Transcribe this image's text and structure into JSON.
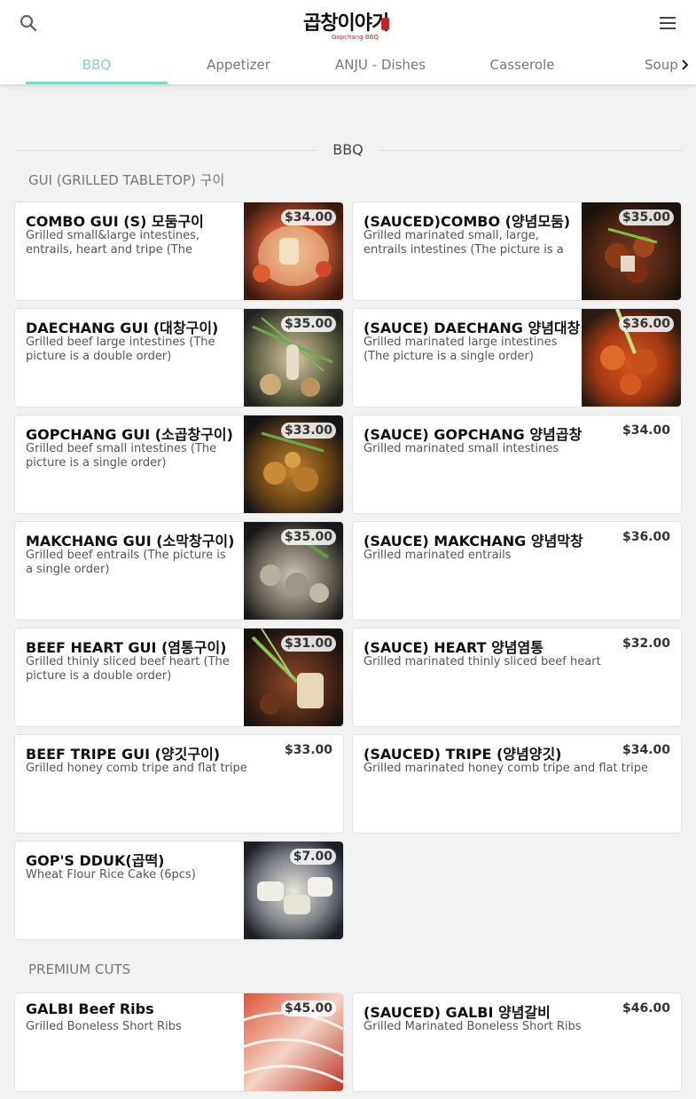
{
  "header": {
    "logo_text": "곱창이야기",
    "logo_subtitle": "Gopchang BBQ",
    "search_icon": "search-icon",
    "menu_icon": "menu-icon"
  },
  "tabs": [
    {
      "label": "BBQ",
      "active": true
    },
    {
      "label": "Appetizer",
      "active": false
    },
    {
      "label": "ANJU - Dishes",
      "active": false
    },
    {
      "label": "Casserole",
      "active": false
    },
    {
      "label": "Soup",
      "active": false
    }
  ],
  "accent_color": "#7fd3c7",
  "section": {
    "title": "BBQ",
    "categories": [
      {
        "name": "GUI (GRILLED TABLETOP) 구이",
        "items": [
          {
            "name": "COMBO GUI (S) 모둠구이",
            "description": "Grilled small&large intestines, entrails, heart and tripe (The picture is a double order)",
            "price": "$34.00",
            "image": "combo-gui-photo"
          },
          {
            "name": "(SAUCED)COMBO (양념모둠)",
            "description": "Grilled marinated small, large, entrails intestines (The picture is a double order)",
            "price": "$35.00",
            "image": "sauced-combo-photo"
          },
          {
            "name": "DAECHANG GUI (대창구이)",
            "description": "Grilled beef large intestines (The picture is a double order)",
            "price": "$35.00",
            "image": "daechang-gui-photo"
          },
          {
            "name": "(SAUCE) DAECHANG 양념대창",
            "description": "Grilled marinated large intestines (The picture is a single order)",
            "price": "$36.00",
            "image": "sauce-daechang-photo"
          },
          {
            "name": "GOPCHANG GUI (소곱창구이)",
            "description": "Grilled beef small intestines (The picture is a single order)",
            "price": "$33.00",
            "image": "gopchang-gui-photo"
          },
          {
            "name": "(SAUCE) GOPCHANG 양념곱창",
            "description": "Grilled marinated small intestines",
            "price": "$34.00",
            "image": ""
          },
          {
            "name": "MAKCHANG GUI (소막창구이)",
            "description": "Grilled beef entrails (The picture is a single order)",
            "price": "$35.00",
            "image": "makchang-gui-photo"
          },
          {
            "name": "(SAUCE) MAKCHANG 양념막창",
            "description": "Grilled marinated entrails",
            "price": "$36.00",
            "image": ""
          },
          {
            "name": "BEEF HEART GUI (염통구이)",
            "description": "Grilled thinly sliced beef heart (The picture is a double order)",
            "price": "$31.00",
            "image": "beef-heart-gui-photo"
          },
          {
            "name": "(SAUCE) HEART 양념염통",
            "description": "Grilled marinated thinly sliced beef heart",
            "price": "$32.00",
            "image": ""
          },
          {
            "name": "BEEF TRIPE GUI (양깃구이)",
            "description": "Grilled honey comb tripe and flat tripe",
            "price": "$33.00",
            "image": ""
          },
          {
            "name": "(SAUCED) TRIPE (양념양깃)",
            "description": "Grilled marinated honey comb tripe and flat tripe",
            "price": "$34.00",
            "image": ""
          },
          {
            "name": "GOP'S DDUK(곱떡)",
            "description": "Wheat Flour Rice Cake (6pcs)",
            "price": "$7.00",
            "image": "gops-dduk-photo"
          }
        ]
      },
      {
        "name": "PREMIUM CUTS",
        "items": [
          {
            "name": "GALBI Beef Ribs",
            "description": "Grilled Boneless Short Ribs",
            "price": "$45.00",
            "image": "galbi-photo"
          },
          {
            "name": "(SAUCED) GALBI 양념갈비",
            "description": "Grilled Marinated Boneless Short Ribs",
            "price": "$46.00",
            "image": ""
          }
        ]
      }
    ]
  }
}
